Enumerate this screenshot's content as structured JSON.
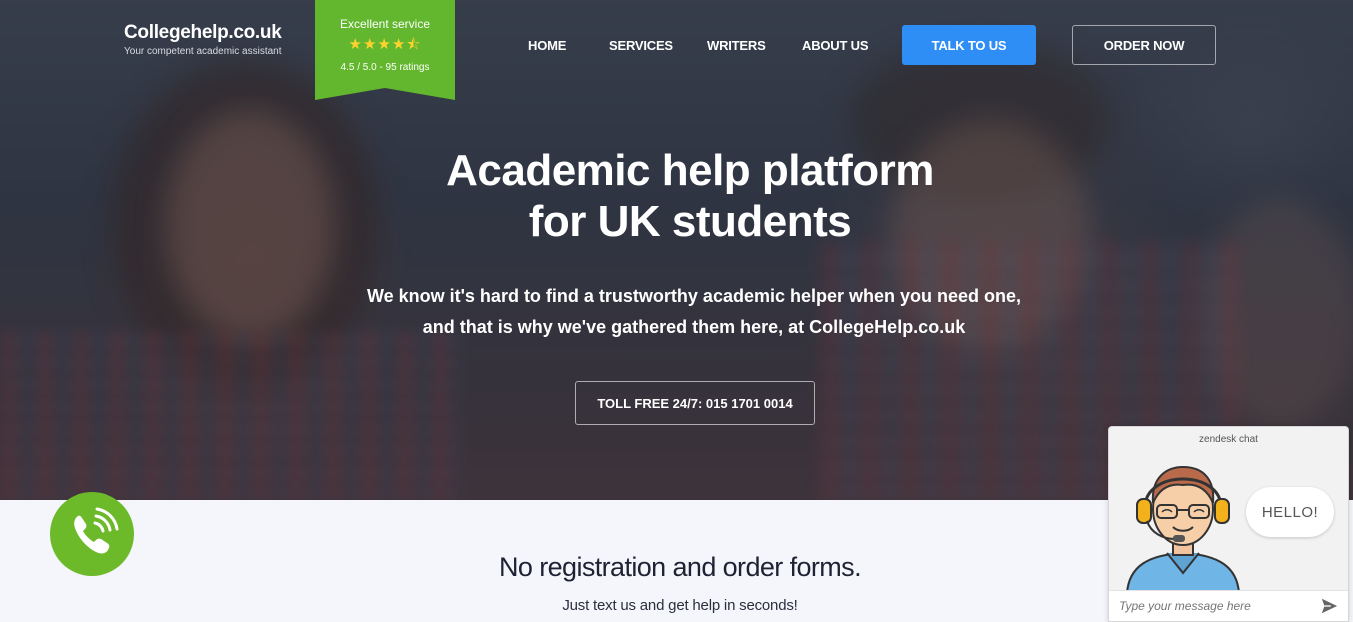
{
  "header": {
    "logo_title": "Collegehelp.co.uk",
    "logo_subtitle": "Your competent academic assistant",
    "rating": {
      "title": "Excellent service",
      "stars": "★★★★⯪",
      "score": "4.5 / 5.0 - 95 ratings",
      "value": 4.5,
      "max": 5
    },
    "nav": {
      "home": "HOME",
      "services": "SERVICES",
      "writers": "WRITERS",
      "about": "ABOUT US"
    },
    "talk_button": "TALK TO US",
    "order_button": "ORDER NOW"
  },
  "hero": {
    "title_line1": "Academic help platform",
    "title_line2": "for UK students",
    "subtitle_line1": "We know it's hard to find a trustworthy academic helper when you need one,",
    "subtitle_line2": "and that is why we've gathered them here, at CollegeHelp.co.uk",
    "tollfree": "TOLL FREE 24/7: 015 1701 0014"
  },
  "section": {
    "title": "No registration and order forms.",
    "subtitle": "Just text us and get help in seconds!"
  },
  "chat": {
    "brand": "zendesk chat",
    "greeting": "HELLO!",
    "input_placeholder": "Type your message here"
  },
  "colors": {
    "accent_green": "#62b72e",
    "phone_green": "#6cba2a",
    "talk_blue": "#2e8ef5",
    "star_yellow": "#ffd22e"
  },
  "icons": {
    "phone": "phone-icon",
    "send": "send-icon",
    "agent": "agent-avatar-icon"
  }
}
